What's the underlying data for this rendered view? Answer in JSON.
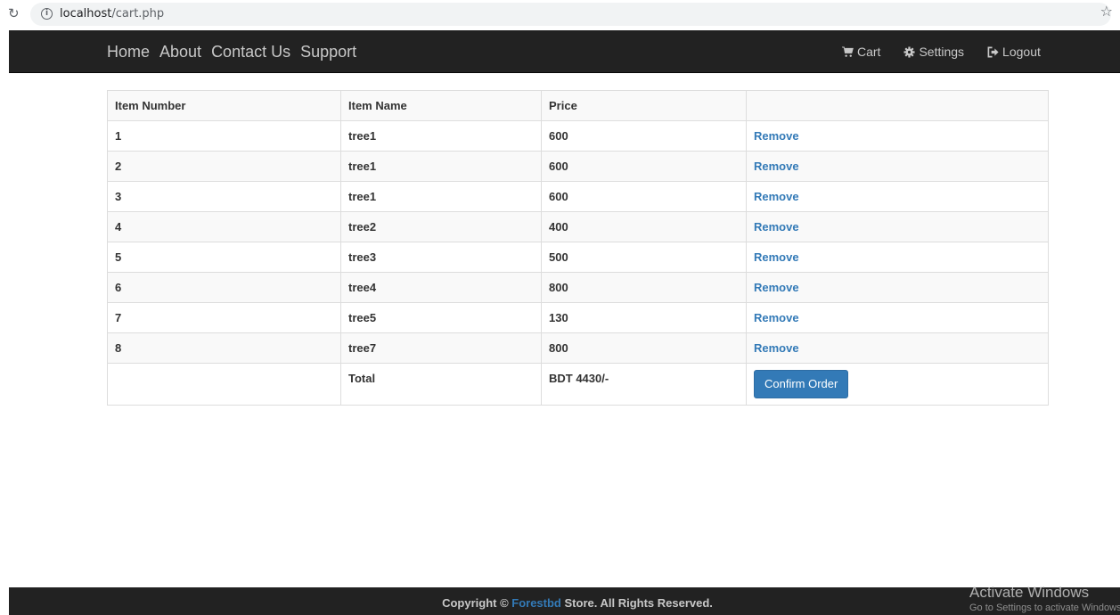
{
  "browser": {
    "url_host": "localhost",
    "url_path": "/cart.php"
  },
  "navbar": {
    "left_links": [
      "Home",
      "About",
      "Contact Us",
      "Support"
    ],
    "cart_label": "Cart",
    "settings_label": "Settings",
    "logout_label": "Logout"
  },
  "table": {
    "headers": [
      "Item Number",
      "Item Name",
      "Price",
      ""
    ],
    "rows": [
      {
        "number": "1",
        "name": "tree1",
        "price": "600",
        "action": "Remove"
      },
      {
        "number": "2",
        "name": "tree1",
        "price": "600",
        "action": "Remove"
      },
      {
        "number": "3",
        "name": "tree1",
        "price": "600",
        "action": "Remove"
      },
      {
        "number": "4",
        "name": "tree2",
        "price": "400",
        "action": "Remove"
      },
      {
        "number": "5",
        "name": "tree3",
        "price": "500",
        "action": "Remove"
      },
      {
        "number": "6",
        "name": "tree4",
        "price": "800",
        "action": "Remove"
      },
      {
        "number": "7",
        "name": "tree5",
        "price": "130",
        "action": "Remove"
      },
      {
        "number": "8",
        "name": "tree7",
        "price": "800",
        "action": "Remove"
      }
    ],
    "total_label": "Total",
    "total_value": "BDT 4430/-",
    "confirm_label": "Confirm Order"
  },
  "footer": {
    "prefix": "Copyright © ",
    "brand": "Forestbd",
    "suffix": " Store. All Rights Reserved."
  },
  "watermark": {
    "title": "Activate Windows",
    "subtitle": "Go to Settings to activate Windows."
  },
  "colors": {
    "navbar_bg": "#222222",
    "link_blue": "#337ab7",
    "button_blue": "#337ab7"
  }
}
